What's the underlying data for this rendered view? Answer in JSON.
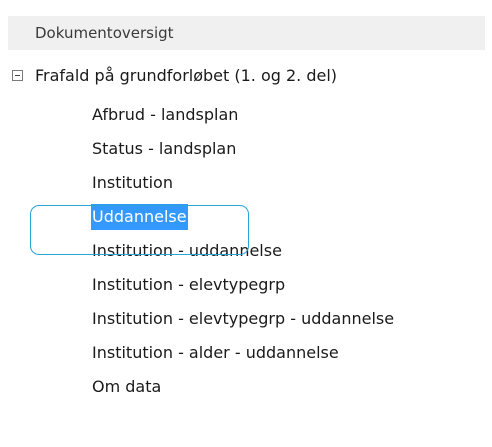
{
  "panel": {
    "title": "Dokumentoversigt"
  },
  "tree": {
    "root": {
      "label": "Frafald på grundforløbet (1. og 2. del)",
      "expanded": true
    },
    "children": [
      {
        "label": "Afbrud - landsplan",
        "selected": false
      },
      {
        "label": "Status - landsplan",
        "selected": false
      },
      {
        "label": "Institution",
        "selected": false
      },
      {
        "label": "Uddannelse",
        "selected": true
      },
      {
        "label": "Institution - uddannelse",
        "selected": false
      },
      {
        "label": "Institution - elevtypegrp",
        "selected": false
      },
      {
        "label": "Institution - elevtypegrp - uddannelse",
        "selected": false
      },
      {
        "label": "Institution - alder - uddannelse",
        "selected": false
      },
      {
        "label": "Om data",
        "selected": false
      }
    ]
  },
  "colors": {
    "selection_background": "#3399ff",
    "selection_text": "#ffffff",
    "highlight_outline": "#2aa3d8",
    "header_background": "#f0f0f0"
  }
}
